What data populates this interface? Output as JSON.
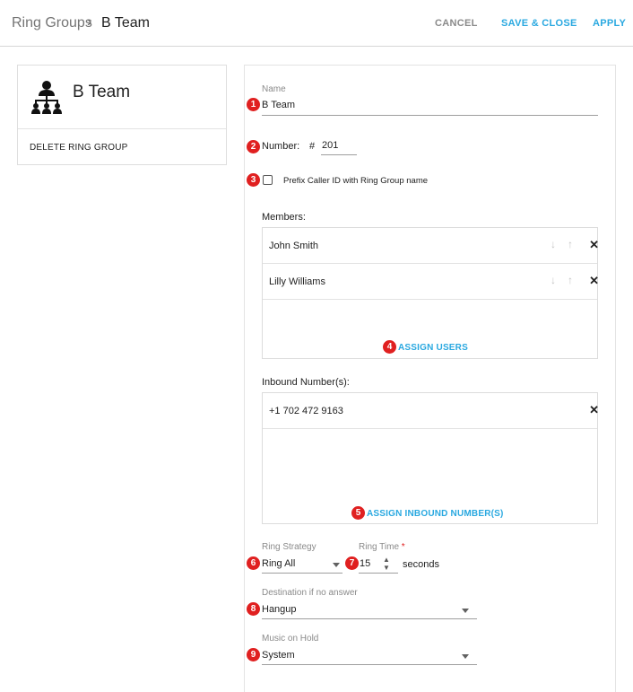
{
  "header": {
    "breadcrumb_root": "Ring Groups",
    "breadcrumb_sep": "›",
    "breadcrumb_current": "B Team",
    "cancel_label": "CANCEL",
    "save_close_label": "SAVE & CLOSE",
    "apply_label": "APPLY"
  },
  "left_card": {
    "title": "B Team",
    "icon": "ring-group-org-icon",
    "delete_label": "DELETE RING GROUP"
  },
  "form": {
    "name_label": "Name",
    "name_value": "B Team",
    "number_label": "Number:",
    "number_prefix": "#",
    "number_value": "201",
    "prefix_label": "Prefix Caller ID with Ring Group name",
    "prefix_checked": false,
    "members_label": "Members:",
    "members": [
      {
        "name": "John Smith"
      },
      {
        "name": "Lilly Williams"
      }
    ],
    "assign_users_label": "ASSIGN USERS",
    "inbound_label": "Inbound Number(s):",
    "inbound_numbers": [
      "+1 702 472 9163"
    ],
    "assign_inbound_label": "ASSIGN INBOUND NUMBER(S)",
    "ring_strategy_label": "Ring Strategy",
    "ring_strategy_value": "Ring All",
    "ring_time_label": "Ring Time",
    "ring_time_required": "*",
    "ring_time_value": "15",
    "ring_time_unit": "seconds",
    "destination_label": "Destination if no answer",
    "destination_value": "Hangup",
    "moh_label": "Music on Hold",
    "moh_value": "System"
  },
  "icons": {
    "down_arrow": "↓",
    "up_arrow": "↑",
    "remove": "✕",
    "spin_up": "▲",
    "spin_down": "▼"
  },
  "badges": [
    "1",
    "2",
    "3",
    "4",
    "5",
    "6",
    "7",
    "8",
    "9"
  ],
  "colors": {
    "accent": "#29a8e0",
    "badge": "#e02020"
  }
}
